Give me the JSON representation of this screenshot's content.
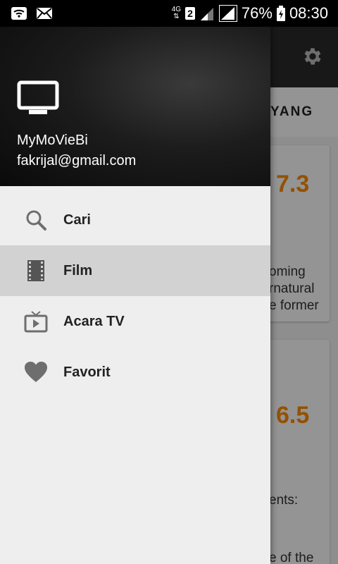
{
  "status_bar": {
    "network": "4G",
    "sim_slot": "2",
    "battery": "76%",
    "time": "08:30"
  },
  "drawer": {
    "app_name": "MyMoVieBi",
    "email": "fakrijal@gmail.com",
    "items": [
      {
        "label": "Cari",
        "icon": "search-icon",
        "active": false
      },
      {
        "label": "Film",
        "icon": "film-icon",
        "active": true
      },
      {
        "label": "Acara TV",
        "icon": "tv-show-icon",
        "active": false
      },
      {
        "label": "Favorit",
        "icon": "heart-icon",
        "active": false
      }
    ]
  },
  "background": {
    "tab_partial": "YANG",
    "card1": {
      "rating": "7.3",
      "lines": [
        "oming",
        "rnatural",
        "e former"
      ]
    },
    "card2": {
      "rating": "6.5",
      "lines": [
        "ents:",
        "e of the"
      ]
    }
  },
  "colors": {
    "rating": "#ff8c00",
    "active_item": "#d2d2d2"
  }
}
